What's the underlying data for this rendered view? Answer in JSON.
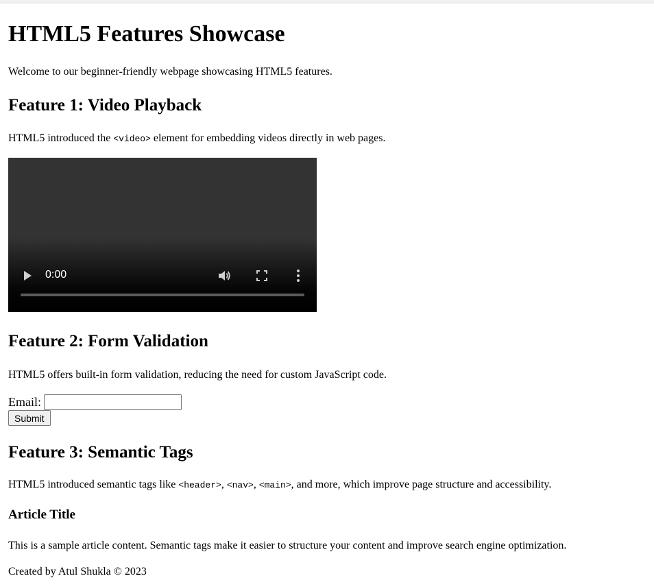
{
  "page": {
    "title": "HTML5 Features Showcase",
    "intro": "Welcome to our beginner-friendly webpage showcasing HTML5 features."
  },
  "feature1": {
    "heading": "Feature 1: Video Playback",
    "text_before": "HTML5 introduced the ",
    "code": "<video>",
    "text_after": " element for embedding videos directly in web pages.",
    "video": {
      "time": "0:00",
      "progress": 0,
      "icons": [
        "play-icon",
        "volume-icon",
        "fullscreen-icon",
        "more-options-icon"
      ]
    }
  },
  "feature2": {
    "heading": "Feature 2: Form Validation",
    "text": "HTML5 offers built-in form validation, reducing the need for custom JavaScript code.",
    "email_label": "Email:",
    "email_value": "",
    "submit_label": "Submit"
  },
  "feature3": {
    "heading": "Feature 3: Semantic Tags",
    "text_before": "HTML5 introduced semantic tags like ",
    "code1": "<header>",
    "sep1": ", ",
    "code2": "<nav>",
    "sep2": ", ",
    "code3": "<main>",
    "text_after": ", and more, which improve page structure and accessibility.",
    "article_title": "Article Title",
    "article_text": "This is a sample article content. Semantic tags make it easier to structure your content and improve search engine optimization."
  },
  "footer": {
    "text": "Created by Atul Shukla © 2023"
  }
}
